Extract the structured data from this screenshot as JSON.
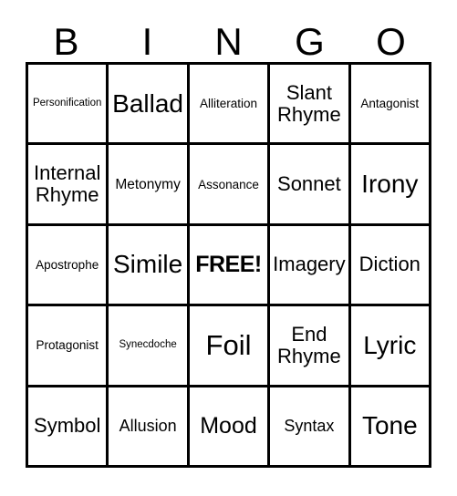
{
  "card": {
    "title_letters": [
      "B",
      "I",
      "N",
      "G",
      "O"
    ],
    "free_space_label": "FREE!",
    "colors": {
      "border": "#000000",
      "text": "#000000",
      "background": "#ffffff"
    },
    "rows": [
      [
        {
          "label": "Personification",
          "size": "fs-xs"
        },
        {
          "label": "Ballad",
          "size": "fs-3xl"
        },
        {
          "label": "Alliteration",
          "size": "fs-sm"
        },
        {
          "label": "Slant\nRhyme",
          "size": "fs-wrap-lg"
        },
        {
          "label": "Antagonist",
          "size": "fs-sm"
        }
      ],
      [
        {
          "label": "Internal\nRhyme",
          "size": "fs-wrap-lg"
        },
        {
          "label": "Metonymy",
          "size": "fs-md"
        },
        {
          "label": "Assonance",
          "size": "fs-sm"
        },
        {
          "label": "Sonnet",
          "size": "fs-xl"
        },
        {
          "label": "Irony",
          "size": "fs-3xl"
        }
      ],
      [
        {
          "label": "Apostrophe",
          "size": "fs-sm"
        },
        {
          "label": "Simile",
          "size": "fs-3xl"
        },
        {
          "label": "FREE!",
          "size": "free"
        },
        {
          "label": "Imagery",
          "size": "fs-xl"
        },
        {
          "label": "Diction",
          "size": "fs-xl"
        }
      ],
      [
        {
          "label": "Protagonist",
          "size": "fs-sm"
        },
        {
          "label": "Synecdoche",
          "size": "fs-xs"
        },
        {
          "label": "Foil",
          "size": "fs-4xl"
        },
        {
          "label": "End\nRhyme",
          "size": "fs-wrap-lg"
        },
        {
          "label": "Lyric",
          "size": "fs-3xl"
        }
      ],
      [
        {
          "label": "Symbol",
          "size": "fs-xl"
        },
        {
          "label": "Allusion",
          "size": "fs-lg"
        },
        {
          "label": "Mood",
          "size": "fs-2xl"
        },
        {
          "label": "Syntax",
          "size": "fs-lg"
        },
        {
          "label": "Tone",
          "size": "fs-3xl"
        }
      ]
    ]
  }
}
